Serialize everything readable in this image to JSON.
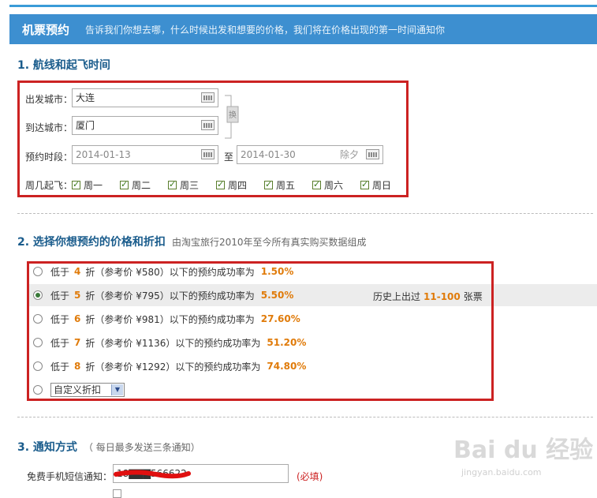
{
  "header": {
    "title": "机票预约",
    "desc": "告诉我们你想去哪，什么时候出发和想要的价格，我们将在价格出现的第一时间通知你"
  },
  "section1": {
    "title": "1. 航线和起飞时间",
    "from_label": "出发城市：",
    "from_value": "大连",
    "to_label": "到达城市：",
    "to_value": "厦门",
    "swap_label": "换",
    "period_label": "预约时段：",
    "start_date": "2014-01-13",
    "to_word": "至",
    "end_date": "2014-01-30",
    "holiday": "除夕",
    "weekday_label": "周几起飞：",
    "weekdays": [
      "周一",
      "周二",
      "周三",
      "周四",
      "周五",
      "周六",
      "周日"
    ]
  },
  "section2": {
    "title": "2. 选择你想预约的价格和折扣",
    "subtitle": "由淘宝旅行2010年至今所有真实购买数据组成",
    "options": [
      {
        "pre": "低于",
        "discount": "4",
        "mid": "折（参考价 ¥580）以下的预约成功率为",
        "rate": "1.50%",
        "selected": false
      },
      {
        "pre": "低于",
        "discount": "5",
        "mid": "折（参考价 ¥795）以下的预约成功率为",
        "rate": "5.50%",
        "selected": true
      },
      {
        "pre": "低于",
        "discount": "6",
        "mid": "折（参考价 ¥981）以下的预约成功率为",
        "rate": "27.60%",
        "selected": false
      },
      {
        "pre": "低于",
        "discount": "7",
        "mid": "折（参考价 ¥1136）以下的预约成功率为",
        "rate": "51.20%",
        "selected": false
      },
      {
        "pre": "低于",
        "discount": "8",
        "mid": "折（参考价 ¥1292）以下的预约成功率为",
        "rate": "74.80%",
        "selected": false
      }
    ],
    "custom_label": "自定义折扣",
    "history_pre": "历史上出过",
    "history_range": "11-100",
    "history_post": "张票"
  },
  "section3": {
    "title": "3. 通知方式",
    "subtitle": "（ 每日最多发送三条通知）",
    "sms_label": "免费手机短信通知：",
    "phone_value": "18▇▇▇566622",
    "required": "(必填)"
  },
  "watermark": {
    "brand": "Bai du 经验",
    "url": "jingyan.baidu.com"
  },
  "colors": {
    "header_bg": "#3d8fd0",
    "accent_orange": "#e07b0a",
    "highlight_red": "#cc2222",
    "section_title": "#1a5c8c"
  }
}
